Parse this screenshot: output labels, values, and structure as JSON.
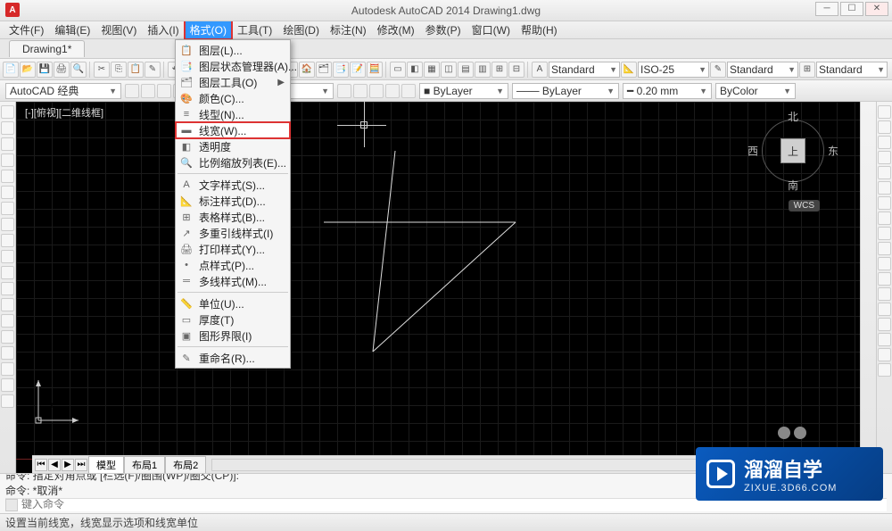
{
  "title": "Autodesk AutoCAD 2014    Drawing1.dwg",
  "app_icon": "A",
  "menubar": [
    {
      "label": "文件(F)"
    },
    {
      "label": "编辑(E)"
    },
    {
      "label": "视图(V)"
    },
    {
      "label": "插入(I)"
    },
    {
      "label": "格式(O)",
      "open": true,
      "boxed": true
    },
    {
      "label": "工具(T)"
    },
    {
      "label": "绘图(D)"
    },
    {
      "label": "标注(N)"
    },
    {
      "label": "修改(M)"
    },
    {
      "label": "参数(P)"
    },
    {
      "label": "窗口(W)"
    },
    {
      "label": "帮助(H)"
    }
  ],
  "doctab": "Drawing1*",
  "workspace_combo": "AutoCAD 经典",
  "std_combos": {
    "anno": "Standard",
    "dim": "ISO-25",
    "text": "Standard",
    "table": "Standard"
  },
  "proprow": {
    "layer_color": "ByLayer",
    "lineweight": "0.20 mm",
    "plot_style": "ByColor"
  },
  "canvas_label": "[-][俯视][二维线框]",
  "compass": {
    "n": "北",
    "s": "南",
    "e": "东",
    "w": "西",
    "top": "上"
  },
  "wcs": "WCS",
  "ucs": {
    "x": "X",
    "y": "Y"
  },
  "bottom_tabs": {
    "model": "模型",
    "layout1": "布局1",
    "layout2": "布局2"
  },
  "command_history": [
    "命令: 指定对角点或 [栏选(F)/圈围(WP)/圈交(CP)]:",
    "命令: *取消*"
  ],
  "cmd_prompt_placeholder": "键入命令",
  "statusbar": "设置当前线宽，线宽显示选项和线宽单位",
  "dropdown": [
    {
      "label": "图层(L)...",
      "icon": "📋"
    },
    {
      "label": "图层状态管理器(A)...",
      "icon": "📑"
    },
    {
      "label": "图层工具(O)",
      "icon": "🗂",
      "submenu": true
    },
    {
      "label": "颜色(C)...",
      "icon": "🎨"
    },
    {
      "label": "线型(N)...",
      "icon": "≡"
    },
    {
      "label": "线宽(W)...",
      "icon": "▬",
      "highlight": true
    },
    {
      "label": "透明度",
      "icon": "◧"
    },
    {
      "label": "比例缩放列表(E)...",
      "icon": "🔍"
    },
    {
      "sep": true
    },
    {
      "label": "文字样式(S)...",
      "icon": "A"
    },
    {
      "label": "标注样式(D)...",
      "icon": "📐"
    },
    {
      "label": "表格样式(B)...",
      "icon": "⊞"
    },
    {
      "label": "多重引线样式(I)",
      "icon": "↗"
    },
    {
      "label": "打印样式(Y)...",
      "icon": "🖨"
    },
    {
      "label": "点样式(P)...",
      "icon": "•"
    },
    {
      "label": "多线样式(M)...",
      "icon": "═"
    },
    {
      "sep": true
    },
    {
      "label": "单位(U)...",
      "icon": "📏"
    },
    {
      "label": "厚度(T)",
      "icon": "▭"
    },
    {
      "label": "图形界限(I)",
      "icon": "▣"
    },
    {
      "sep": true
    },
    {
      "label": "重命名(R)...",
      "icon": "✎"
    }
  ],
  "watermark": {
    "main": "溜溜自学",
    "sub": "ZIXUE.3D66.COM"
  },
  "chart_data": null
}
